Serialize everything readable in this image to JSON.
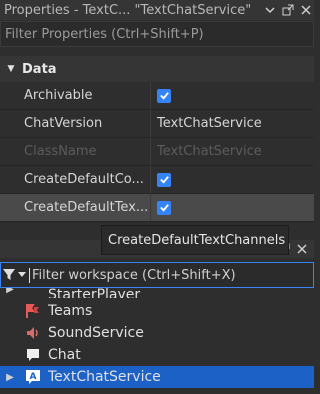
{
  "properties_panel": {
    "title": "Properties - TextC... \"TextChatService\"",
    "filter_placeholder": "Filter Properties (Ctrl+Shift+P)",
    "section_label": "Data",
    "rows": [
      {
        "name": "Archivable",
        "value_type": "checkbox",
        "checked": true
      },
      {
        "name": "ChatVersion",
        "value": "TextChatService"
      },
      {
        "name": "ClassName",
        "value": "TextChatService",
        "disabled": true
      },
      {
        "name": "CreateDefaultCo...",
        "value_type": "checkbox",
        "checked": true
      },
      {
        "name": "CreateDefaultTex...",
        "value_type": "checkbox",
        "checked": true,
        "selected": true
      }
    ],
    "tooltip": "CreateDefaultTextChannels"
  },
  "explorer_panel": {
    "filter_placeholder": "Filter workspace (Ctrl+Shift+X)",
    "items": [
      {
        "label": "StarterPlayer",
        "icon": "starter-player-icon",
        "partial": true
      },
      {
        "label": "Teams",
        "icon": "teams-icon"
      },
      {
        "label": "SoundService",
        "icon": "sound-service-icon"
      },
      {
        "label": "Chat",
        "icon": "chat-icon"
      },
      {
        "label": "TextChatService",
        "icon": "text-chat-service-icon",
        "selected": true,
        "expandable": true
      }
    ]
  },
  "colors": {
    "accent": "#3584f5",
    "selection": "#1b61c6",
    "background": "#2e2e2e"
  }
}
